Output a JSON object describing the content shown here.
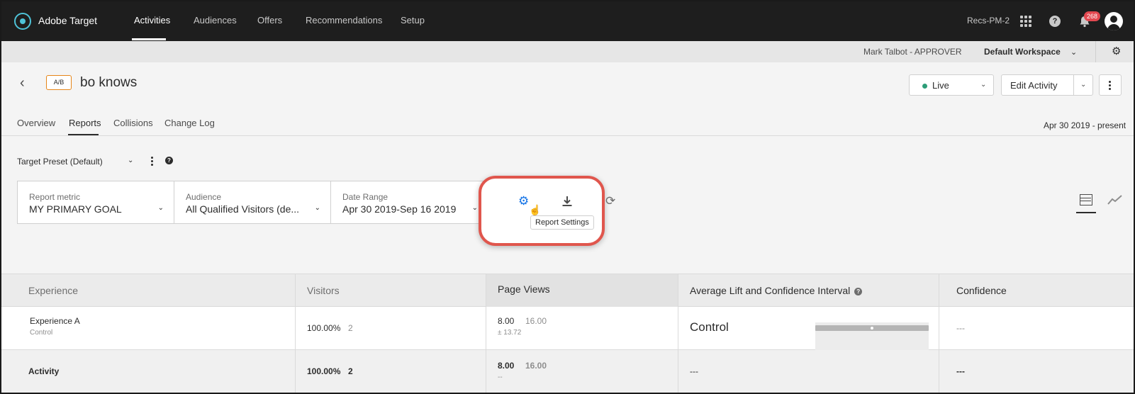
{
  "topnav": {
    "brand": "Adobe Target",
    "links": [
      "Activities",
      "Audiences",
      "Offers",
      "Recommendations",
      "Setup"
    ],
    "org": "Recs-PM-2",
    "notification_count": "268"
  },
  "workspace_bar": {
    "user": "Mark Talbot - APPROVER",
    "workspace": "Default Workspace"
  },
  "activity": {
    "type_badge": "A/B",
    "title": "bo knows",
    "status": "Live",
    "status_color": "#2d9d78",
    "edit_label": "Edit Activity"
  },
  "tabs": {
    "items": [
      "Overview",
      "Reports",
      "Collisions",
      "Change Log"
    ],
    "active": "Reports",
    "date_range_text": "Apr 30 2019 - present"
  },
  "preset": {
    "label": "Target Preset (Default)"
  },
  "filters": [
    {
      "label": "Report metric",
      "value": "MY PRIMARY GOAL"
    },
    {
      "label": "Audience",
      "value": "All Qualified Visitors (de..."
    },
    {
      "label": "Date Range",
      "value": "Apr 30 2019-Sep 16 2019"
    }
  ],
  "toolbar": {
    "tooltip": "Report Settings",
    "settings_icon": "gear-icon",
    "download_icon": "download-icon",
    "refresh_icon": "refresh-icon",
    "highlight_color": "#e0564d",
    "accent_color": "#1473e6"
  },
  "table": {
    "headers": [
      "Experience",
      "Visitors",
      "Page Views",
      "Average Lift and Confidence Interval",
      "Confidence"
    ],
    "rows": [
      {
        "experience": "Experience A",
        "sub": "Control",
        "visitors_pct": "100.00%",
        "visitors_count": "2",
        "pv_rate": "8.00",
        "pv_total": "16.00",
        "pv_ci": "± 13.72",
        "lift": "Control",
        "confidence": "---"
      },
      {
        "experience": "Activity",
        "visitors_pct": "100.00%",
        "visitors_count": "2",
        "pv_rate": "8.00",
        "pv_total": "16.00",
        "pv_ci": "--",
        "lift": "---",
        "confidence": "---"
      }
    ]
  }
}
